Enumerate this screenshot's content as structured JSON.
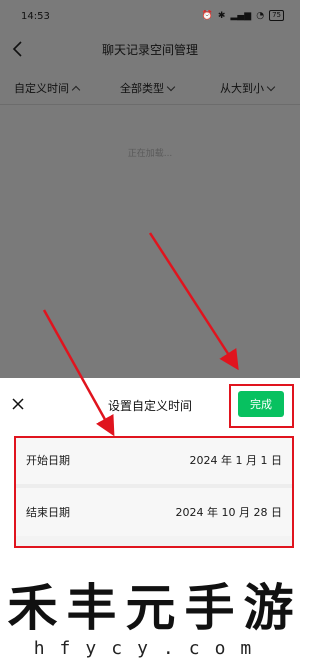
{
  "status_bar": {
    "time": "14:53",
    "battery": "75"
  },
  "nav": {
    "title": "聊天记录空间管理"
  },
  "filters": [
    {
      "label": "自定义时间",
      "chevron": "up"
    },
    {
      "label": "全部类型",
      "chevron": "down"
    },
    {
      "label": "从大到小",
      "chevron": "down"
    }
  ],
  "loading_text": "正在加载...",
  "sheet": {
    "title": "设置自定义时间",
    "done_label": "完成",
    "start_label": "开始日期",
    "start_value": "2024 年 1 月 1 日",
    "end_label": "结束日期",
    "end_value": "2024 年 10 月 28 日"
  },
  "watermark": {
    "chars": [
      "禾",
      "丰",
      "元",
      "手",
      "游"
    ],
    "latin": "hfycy.com"
  },
  "colors": {
    "accent": "#07c160",
    "annotation": "#e0141e",
    "overlay": "#7a7a7a"
  }
}
